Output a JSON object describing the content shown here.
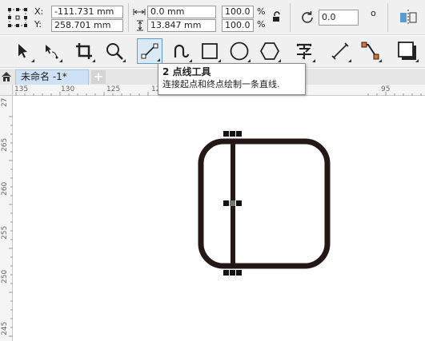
{
  "property_bar": {
    "x_label": "X:",
    "y_label": "Y:",
    "x_value": "-111.731 mm",
    "y_value": "258.701 mm",
    "width_value": "0.0 mm",
    "height_value": "13.847 mm",
    "scale_x": "100.0",
    "scale_y": "100.0",
    "percent": "%",
    "rotation": "0.0",
    "degree": "o"
  },
  "toolbox": {
    "active_tool": "2-point-line"
  },
  "tooltip": {
    "title": "2 点线工具",
    "description": "连接起点和终点绘制一条直线."
  },
  "tabs": {
    "document": "未命名 -1*",
    "add": "+"
  },
  "rulers": {
    "horizontal": [
      "135",
      "130",
      "125",
      "12",
      "95"
    ],
    "vertical": [
      "27",
      "265",
      "260",
      "255",
      "250",
      "245"
    ]
  },
  "colors": {
    "accent": "#5b9bd5",
    "shape": "#231815",
    "tab": "#cfe2f5"
  }
}
